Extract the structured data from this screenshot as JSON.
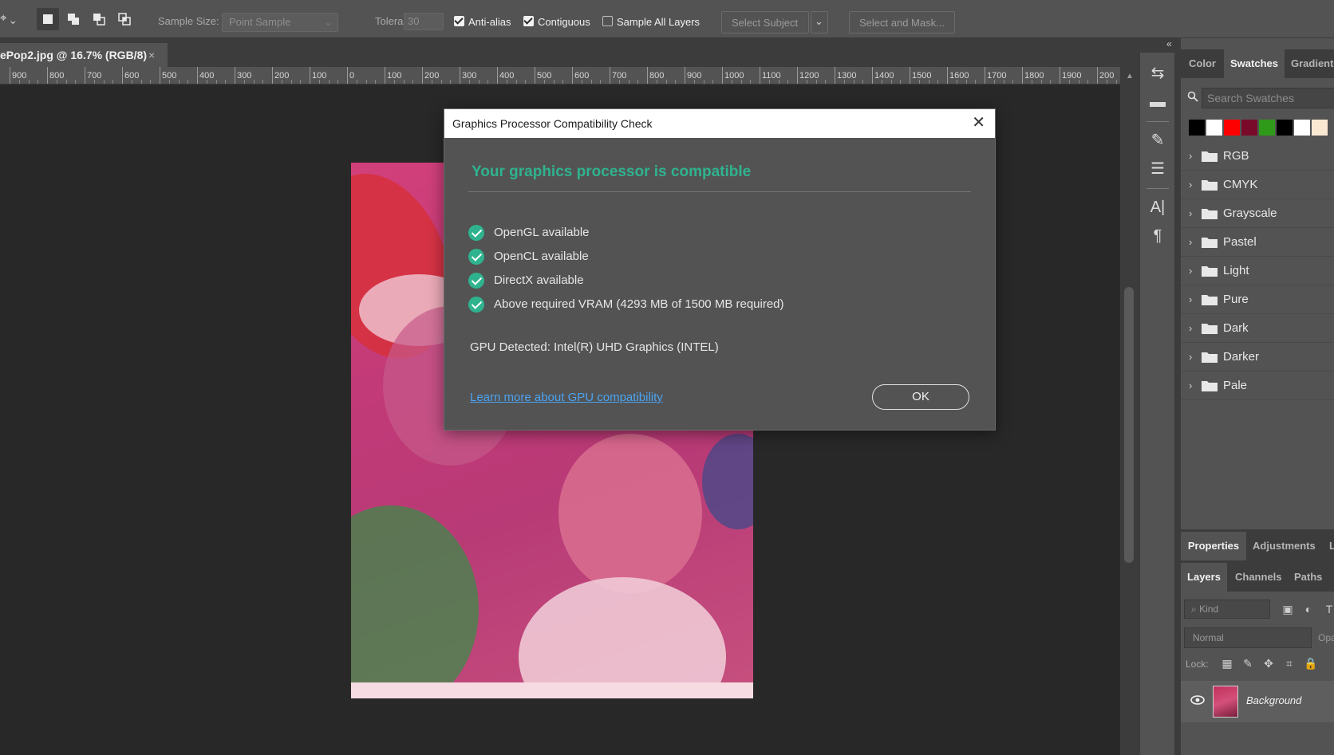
{
  "options_bar": {
    "sample_size_label": "Sample Size:",
    "sample_size_value": "Point Sample",
    "tolerance_label": "Tolerance:",
    "tolerance_value": "30",
    "anti_alias_label": "Anti-alias",
    "anti_alias_checked": true,
    "contiguous_label": "Contiguous",
    "contiguous_checked": true,
    "sample_all_layers_label": "Sample All Layers",
    "sample_all_layers_checked": false,
    "select_subject_label": "Select Subject",
    "select_and_mask_label": "Select and Mask..."
  },
  "document_tab": {
    "title": "ePop2.jpg @ 16.7% (RGB/8)",
    "close_glyph": "×"
  },
  "ruler": {
    "labels": [
      "900",
      "800",
      "700",
      "600",
      "500",
      "400",
      "300",
      "200",
      "100",
      "0",
      "100",
      "200",
      "300",
      "400",
      "500",
      "600",
      "700",
      "800",
      "900",
      "1000",
      "1100",
      "1200",
      "1300",
      "1400",
      "1500",
      "1600",
      "1700",
      "1800",
      "1900",
      "200"
    ]
  },
  "dialog": {
    "title": "Graphics Processor Compatibility Check",
    "heading": "Your graphics processor is compatible",
    "checks": [
      "OpenGL available",
      "OpenCL available",
      "DirectX available",
      "Above required VRAM (4293 MB of 1500 MB required)"
    ],
    "gpu_detected": "GPU Detected: Intel(R) UHD Graphics (INTEL)",
    "learn_more_link": "Learn more about GPU compatibility",
    "ok_button": "OK",
    "accent_color": "#2fb38f",
    "link_color": "#4aa3f3"
  },
  "swatches_panel": {
    "tabs": [
      "Color",
      "Swatches",
      "Gradients"
    ],
    "active_tab": "Swatches",
    "search_placeholder": "Search Swatches",
    "recent_swatches": [
      "#000000",
      "#ffffff",
      "#ff0000",
      "#7a0a2a",
      "#2f9a1a",
      "#000000",
      "#ffffff",
      "#fbe8d2"
    ],
    "groups": [
      "RGB",
      "CMYK",
      "Grayscale",
      "Pastel",
      "Light",
      "Pure",
      "Dark",
      "Darker",
      "Pale"
    ]
  },
  "properties_panel": {
    "tabs": [
      "Properties",
      "Adjustments",
      "L"
    ]
  },
  "layers_panel": {
    "tabs": [
      "Layers",
      "Channels",
      "Paths"
    ],
    "kind_filter": "Kind",
    "blend_mode": "Normal",
    "opacity_label": "Opa",
    "lock_label": "Lock:",
    "layers": [
      {
        "name": "Background",
        "visible": true
      }
    ]
  }
}
